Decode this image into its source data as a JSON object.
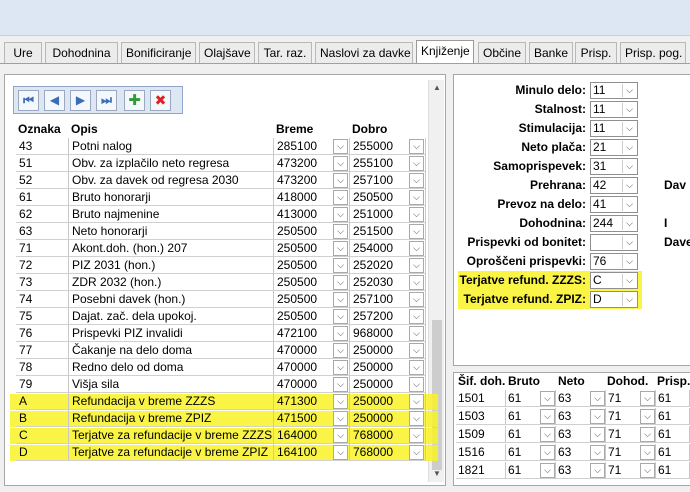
{
  "tabs": [
    "Ure",
    "Dohodnina",
    "Bonificiranje",
    "Olajšave",
    "Tar. raz.",
    "Naslovi za davke",
    "Knjiženje",
    "Občine",
    "Banke",
    "Prisp.",
    "Prisp. pog."
  ],
  "active_tab": "Knjiženje",
  "nav": {
    "first_icon": "first-record-icon",
    "prev_icon": "prev-record-icon",
    "next_icon": "next-record-icon",
    "last_icon": "last-record-icon",
    "add_icon": "add-record-icon",
    "delete_icon": "delete-record-icon"
  },
  "table": {
    "headers": [
      "Oznaka",
      "Opis",
      "Breme",
      "Dobro"
    ],
    "rows": [
      {
        "oznaka": "43",
        "opis": "Potni nalog",
        "breme": "285100",
        "dobro": "255000",
        "highlight": false
      },
      {
        "oznaka": "51",
        "opis": "Obv. za izplačilo neto regresa",
        "breme": "473200",
        "dobro": "255100",
        "highlight": false
      },
      {
        "oznaka": "52",
        "opis": "Obv. za davek od regresa 2030",
        "breme": "473200",
        "dobro": "257100",
        "highlight": false
      },
      {
        "oznaka": "61",
        "opis": "Bruto honorarji",
        "breme": "418000",
        "dobro": "250500",
        "highlight": false
      },
      {
        "oznaka": "62",
        "opis": "Bruto najmenine",
        "breme": "413000",
        "dobro": "251000",
        "highlight": false
      },
      {
        "oznaka": "63",
        "opis": "Neto honorarji",
        "breme": "250500",
        "dobro": "251500",
        "highlight": false
      },
      {
        "oznaka": "71",
        "opis": "Akont.doh. (hon.) 207",
        "breme": "250500",
        "dobro": "254000",
        "highlight": false
      },
      {
        "oznaka": "72",
        "opis": "PIZ 2031 (hon.)",
        "breme": "250500",
        "dobro": "252020",
        "highlight": false
      },
      {
        "oznaka": "73",
        "opis": "ZDR 2032 (hon.)",
        "breme": "250500",
        "dobro": "252030",
        "highlight": false
      },
      {
        "oznaka": "74",
        "opis": "Posebni davek (hon.)",
        "breme": "250500",
        "dobro": "257100",
        "highlight": false
      },
      {
        "oznaka": "75",
        "opis": "Dajat. zač. dela upokoj.",
        "breme": "250500",
        "dobro": "257200",
        "highlight": false
      },
      {
        "oznaka": "76",
        "opis": "Prispevki PIZ invalidi",
        "breme": "472100",
        "dobro": "968000",
        "highlight": false
      },
      {
        "oznaka": "77",
        "opis": "Čakanje na delo doma",
        "breme": "470000",
        "dobro": "250000",
        "highlight": false
      },
      {
        "oznaka": "78",
        "opis": "Redno delo od doma",
        "breme": "470000",
        "dobro": "250000",
        "highlight": false
      },
      {
        "oznaka": "79",
        "opis": "Višja sila",
        "breme": "470000",
        "dobro": "250000",
        "highlight": false
      },
      {
        "oznaka": "A",
        "opis": "Refundacija v breme ZZZS",
        "breme": "471300",
        "dobro": "250000",
        "highlight": true
      },
      {
        "oznaka": "B",
        "opis": "Refundacija v breme ZPIZ",
        "breme": "471500",
        "dobro": "250000",
        "highlight": true
      },
      {
        "oznaka": "C",
        "opis": "Terjatve za refundacije v breme ZZZS",
        "breme": "164000",
        "dobro": "768000",
        "highlight": true
      },
      {
        "oznaka": "D",
        "opis": "Terjatve za refundacije v breme ZPIZ",
        "breme": "164100",
        "dobro": "768000",
        "highlight": true
      }
    ]
  },
  "fields": [
    {
      "label": "Minulo delo:",
      "value": "11",
      "highlight": false
    },
    {
      "label": "Stalnost:",
      "value": "11",
      "highlight": false
    },
    {
      "label": "Stimulacija:",
      "value": "11",
      "highlight": false
    },
    {
      "label": "Neto plača:",
      "value": "21",
      "highlight": false
    },
    {
      "label": "Samoprispevek:",
      "value": "31",
      "highlight": false
    },
    {
      "label": "Prehrana:",
      "value": "42",
      "highlight": false
    },
    {
      "label": "Prevoz na delo:",
      "value": "41",
      "highlight": false
    },
    {
      "label": "Dohodnina:",
      "value": "244",
      "highlight": false
    },
    {
      "label": "Prispevki od bonitet:",
      "value": "",
      "highlight": false
    },
    {
      "label": "Oproščeni prispevki:",
      "value": "76",
      "highlight": false
    },
    {
      "label": "Terjatve refund. ZZZS:",
      "value": "C",
      "highlight": true
    },
    {
      "label": "Terjatve refund. ZPIZ:",
      "value": "D",
      "highlight": true
    }
  ],
  "cut_labels": [
    {
      "row": 5,
      "text": "Dav"
    },
    {
      "row": 7,
      "text": "I"
    },
    {
      "row": 8,
      "text": "Dave"
    }
  ],
  "bottom_table": {
    "headers": [
      "Šif. doh.",
      "Bruto",
      "Neto",
      "Dohod.",
      "Prisp."
    ],
    "rows": [
      [
        "1501",
        "61",
        "63",
        "71",
        "61"
      ],
      [
        "1503",
        "61",
        "63",
        "71",
        "61"
      ],
      [
        "1509",
        "61",
        "63",
        "71",
        "61"
      ],
      [
        "1516",
        "61",
        "63",
        "71",
        "61"
      ],
      [
        "1821",
        "61",
        "63",
        "71",
        "61"
      ]
    ]
  }
}
